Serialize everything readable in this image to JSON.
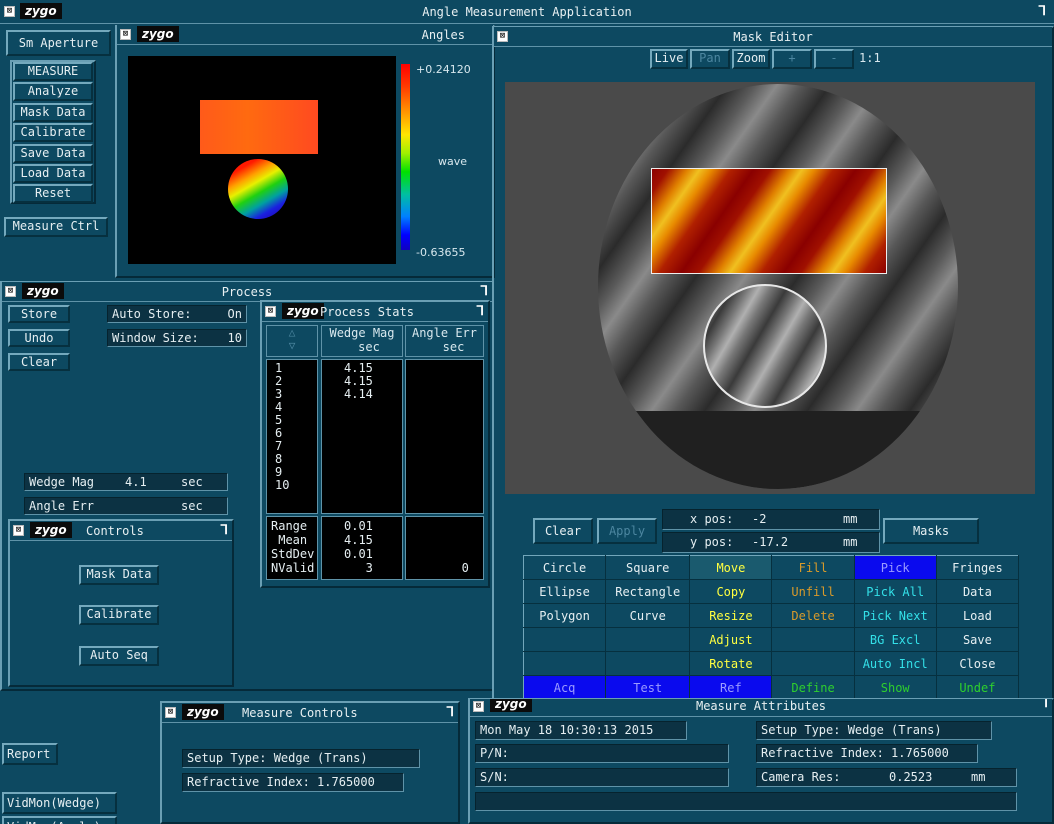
{
  "app": {
    "title": "Angle Measurement Application",
    "logo": "zygo"
  },
  "left_menu": {
    "aperture": "Sm Aperture",
    "items": [
      "MEASURE",
      "Analyze",
      "Mask Data",
      "Calibrate",
      "Save Data",
      "Load Data",
      "Reset"
    ],
    "measure_ctrl": "Measure Ctrl"
  },
  "angles": {
    "title": "Angles",
    "scale_max": "+0.24120",
    "scale_unit": "wave",
    "scale_min": "-0.63655"
  },
  "process": {
    "title": "Process",
    "store": "Store",
    "undo": "Undo",
    "clear": "Clear",
    "auto_store_label": "Auto Store:",
    "auto_store_val": "On",
    "window_size_label": "Window Size:",
    "window_size_val": "10",
    "wedge_mag_label": "Wedge Mag",
    "wedge_mag_val": "4.1",
    "wedge_mag_unit": "sec",
    "angle_err_label": "Angle Err",
    "angle_err_unit": "sec"
  },
  "stats": {
    "title": "Process Stats",
    "col1_h1": "Wedge Mag",
    "col1_h2": "sec",
    "col2_h1": "Angle Err",
    "col2_h2": "sec",
    "rows": "1\n2\n3\n4\n5\n6\n7\n8\n9\n10",
    "col1_vals": "4.15\n4.15\n4.14",
    "sum_labels": "Range\n Mean\nStdDev\nNValid",
    "sum_vals": "0.01\n4.15\n0.01\n   3",
    "sum_col2": "\n\n\n   0"
  },
  "controls": {
    "title": "Controls",
    "mask_data": "Mask Data",
    "calibrate": "Calibrate",
    "auto_seq": "Auto Seq"
  },
  "mask_editor": {
    "title": "Mask Editor",
    "live": "Live",
    "pan": "Pan",
    "zoom": "Zoom",
    "plus": "+",
    "minus": "-",
    "ratio": "1:1",
    "clear": "Clear",
    "apply": "Apply",
    "xpos_label": "x pos:",
    "xpos": "-2",
    "ypos_label": "y pos:",
    "ypos": "-17.2",
    "unit": "mm",
    "masks": "Masks",
    "grid": [
      [
        "Circle",
        "Square",
        "Move",
        "Fill",
        "Pick",
        "Fringes"
      ],
      [
        "Ellipse",
        "Rectangle",
        "Copy",
        "Unfill",
        "Pick All",
        "Data"
      ],
      [
        "Polygon",
        "Curve",
        "Resize",
        "Delete",
        "Pick Next",
        "Load"
      ],
      [
        "",
        "",
        "Adjust",
        "",
        "BG Excl",
        "Save"
      ],
      [
        "",
        "",
        "Rotate",
        "",
        "Auto Incl",
        "Close"
      ],
      [
        "Acq",
        "Test",
        "Ref",
        "Define",
        "Show",
        "Undef"
      ]
    ],
    "colors": {
      "yellow": "#ffff40",
      "orange": "#d89a2a",
      "cyan": "#33e0e8",
      "green": "#2ecf2e",
      "blue": "#0a0aee"
    }
  },
  "measure_controls": {
    "title": "Measure Controls",
    "setup_type": "Setup Type: Wedge (Trans)",
    "refractive_index": "Refractive Index: 1.765000"
  },
  "bottom_left": {
    "report": "Report",
    "vidmon": "VidMon(Wedge)",
    "vidmon2": "VidMon(Angle)"
  },
  "measure_attributes": {
    "title": "Measure Attributes",
    "date": "Mon May 18 10:30:13 2015",
    "setup_type": "Setup Type: Wedge (Trans)",
    "pn": "P/N:",
    "sn": "S/N:",
    "refractive_index": "Refractive Index: 1.765000",
    "camera_res_label": "Camera Res:",
    "camera_res_val": "0.2523",
    "camera_res_unit": "mm"
  }
}
